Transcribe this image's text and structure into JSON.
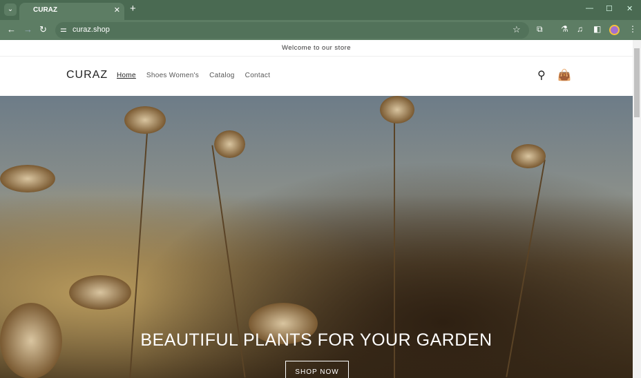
{
  "browser": {
    "tab_title": "CURAZ",
    "url": "curaz.shop"
  },
  "store": {
    "announcement": "Welcome to our store",
    "logo": "CURAZ",
    "menu": [
      "Home",
      "Shoes Women's",
      "Catalog",
      "Contact"
    ],
    "hero_title": "BEAUTIFUL PLANTS FOR YOUR GARDEN",
    "hero_button": "SHOP NOW"
  }
}
